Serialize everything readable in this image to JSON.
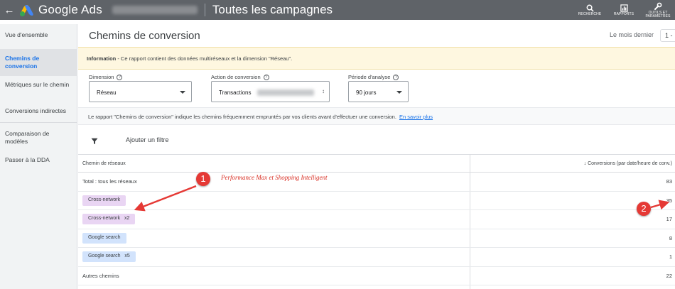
{
  "topbar": {
    "product": "Google Ads",
    "title": "Toutes les campagnes",
    "actions": [
      {
        "label": "RECHERCHE",
        "icon": "search-icon"
      },
      {
        "label": "RAPPORTS",
        "icon": "reports-icon"
      },
      {
        "label": "OUTILS ET PARAMÈTRES",
        "icon": "wrench-icon"
      }
    ]
  },
  "sidebar": {
    "items": [
      {
        "label": "Vue d'ensemble"
      },
      {
        "label": "Chemins de conversion",
        "active": true
      },
      {
        "label": "Métriques sur le chemin"
      },
      {
        "label": "Conversions indirectes"
      },
      {
        "label": "Comparaison de modèles"
      },
      {
        "label": "Passer à la DDA"
      }
    ]
  },
  "main": {
    "title": "Chemins de conversion",
    "date_range": "Le mois dernier",
    "date_box": "1 -",
    "info_label": "Information",
    "info_text": " - Ce rapport contient des données multiréseaux et la dimension \"Réseau\".",
    "fields": {
      "dimension": {
        "label": "Dimension",
        "value": "Réseau"
      },
      "action": {
        "label": "Action de conversion",
        "value": "Transactions"
      },
      "period": {
        "label": "Période d'analyse",
        "value": "90 jours"
      }
    },
    "note": "Le rapport \"Chemins de conversion\" indique les chemins fréquemment empruntés par vos clients avant d'effectuer une conversion.",
    "learn_more": "En savoir plus",
    "add_filter": "Ajouter un filtre"
  },
  "table": {
    "col_path": "Chemin de réseaux",
    "col_conv": "Conversions (par date/heure de conv.)",
    "rows": [
      {
        "path": "Total : tous les réseaux",
        "chip": null,
        "value": "83"
      },
      {
        "path": "Cross-network",
        "chip": "purple",
        "value": "35"
      },
      {
        "path": "Cross-network   x2",
        "chip": "purple",
        "value": "17"
      },
      {
        "path": "Google search",
        "chip": "blue",
        "value": "8"
      },
      {
        "path": "Google search   x5",
        "chip": "blue",
        "value": "1"
      },
      {
        "path": "Autres chemins",
        "chip": null,
        "value": "22"
      }
    ]
  },
  "annotations": {
    "text": "Performance Max et Shopping Intelligent",
    "badge1": "1",
    "badge2": "2",
    "color": "#e53935"
  }
}
